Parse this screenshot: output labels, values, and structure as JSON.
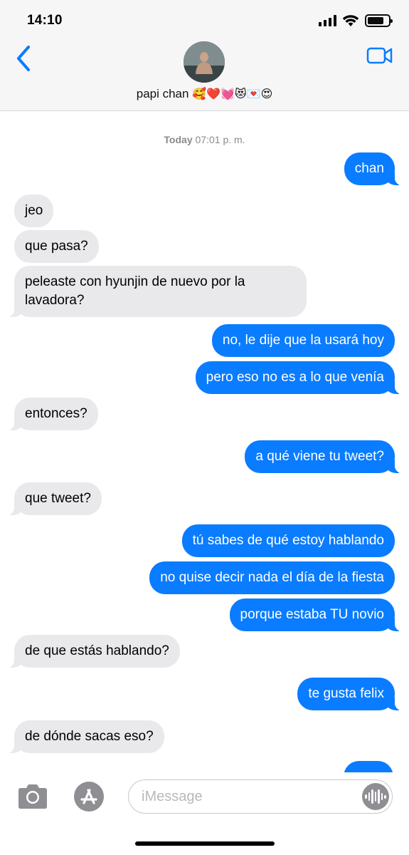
{
  "status_bar": {
    "time": "14:10"
  },
  "header": {
    "contact_name": "papi chan",
    "contact_emojis": "🥰❤️💓😻💌😍"
  },
  "thread": {
    "timestamp_day": "Today",
    "timestamp_time": "07:01 p. m.",
    "messages": [
      {
        "from": "me",
        "text": "chan"
      },
      {
        "from": "them",
        "text": "jeo"
      },
      {
        "from": "them",
        "text": "que pasa?"
      },
      {
        "from": "them",
        "text": "peleaste con hyunjin de nuevo por la\nlavadora?"
      },
      {
        "from": "me",
        "text": "no, le dije que la usará hoy"
      },
      {
        "from": "me",
        "text": "pero eso no es a lo que venía"
      },
      {
        "from": "them",
        "text": "entonces?"
      },
      {
        "from": "me",
        "text": "a qué viene tu tweet?"
      },
      {
        "from": "them",
        "text": "que tweet?"
      },
      {
        "from": "me",
        "text": "tú sabes de qué estoy hablando"
      },
      {
        "from": "me",
        "text": "no quise decir nada el día de la fiesta"
      },
      {
        "from": "me",
        "text": "porque estaba TU novio"
      },
      {
        "from": "them",
        "text": "de que estás hablando?"
      },
      {
        "from": "me",
        "text": "te gusta felix"
      },
      {
        "from": "them",
        "text": "de dónde sacas eso?"
      }
    ]
  },
  "composer": {
    "placeholder": "iMessage"
  },
  "colors": {
    "outgoing": "#0a7cff",
    "incoming": "#e9e9eb",
    "accent": "#0a7cff"
  },
  "icons": [
    "chevron-left-icon",
    "video-camera-icon",
    "camera-icon",
    "app-store-icon",
    "audio-waveform-icon",
    "wifi-icon",
    "signal-icon",
    "battery-icon"
  ]
}
